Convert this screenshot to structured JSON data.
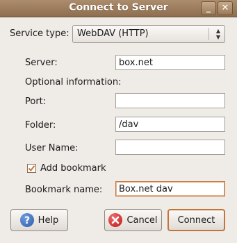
{
  "window": {
    "title": "Connect to Server",
    "minimize_glyph": "_",
    "close_glyph": "✕"
  },
  "service_type": {
    "label": "Service type:",
    "value": "WebDAV (HTTP)"
  },
  "fields": {
    "server": {
      "label": "Server:",
      "value": "box.net"
    },
    "optional_label": "Optional information:",
    "port": {
      "label": "Port:",
      "value": ""
    },
    "folder": {
      "label": "Folder:",
      "value": "/dav"
    },
    "user_name": {
      "label": "User Name:",
      "value": ""
    },
    "add_bookmark": {
      "label": "Add bookmark",
      "checked": true
    },
    "bookmark_name": {
      "label": "Bookmark name:",
      "value": "Box.net dav"
    }
  },
  "buttons": {
    "help": "Help",
    "cancel": "Cancel",
    "connect": "Connect"
  },
  "icons": {
    "help": "help-icon",
    "cancel": "cancel-icon"
  },
  "colors": {
    "titlebar": "#9b7b5b",
    "focus": "#c3743a",
    "help_icon": "#3d6cb0",
    "cancel_icon": "#cc2222"
  }
}
